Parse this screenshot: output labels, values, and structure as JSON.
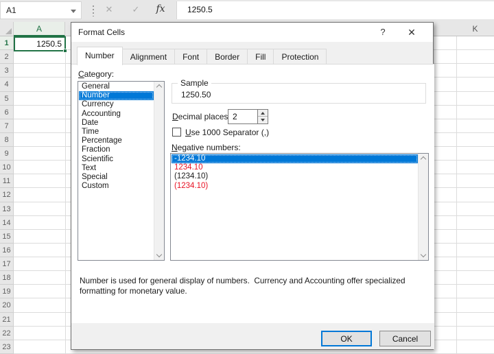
{
  "formula_bar": {
    "name_box": "A1",
    "formula_value": "1250.5",
    "icons": {
      "cancel": "✕",
      "enter": "✓",
      "fx": "fx",
      "dropdown": "▾"
    }
  },
  "grid": {
    "col_a_header": "A",
    "col_k_header": "K",
    "rows": [
      1,
      2,
      3,
      4,
      5,
      6,
      7,
      8,
      9,
      10,
      11,
      12,
      13,
      14,
      15,
      16,
      17,
      18,
      19,
      20,
      21,
      22,
      23
    ],
    "selected_row": 1,
    "selected_column": "A",
    "cell_a1_value": "1250.5"
  },
  "dialog": {
    "title": "Format Cells",
    "help_label": "?",
    "close_label": "✕",
    "tabs": [
      {
        "label": "Number",
        "active": true
      },
      {
        "label": "Alignment",
        "active": false
      },
      {
        "label": "Font",
        "active": false
      },
      {
        "label": "Border",
        "active": false
      },
      {
        "label": "Fill",
        "active": false
      },
      {
        "label": "Protection",
        "active": false
      }
    ],
    "category": {
      "label": "Category:",
      "items": [
        {
          "label": "General",
          "selected": false
        },
        {
          "label": "Number",
          "selected": true
        },
        {
          "label": "Currency",
          "selected": false
        },
        {
          "label": "Accounting",
          "selected": false
        },
        {
          "label": "Date",
          "selected": false
        },
        {
          "label": "Time",
          "selected": false
        },
        {
          "label": "Percentage",
          "selected": false
        },
        {
          "label": "Fraction",
          "selected": false
        },
        {
          "label": "Scientific",
          "selected": false
        },
        {
          "label": "Text",
          "selected": false
        },
        {
          "label": "Special",
          "selected": false
        },
        {
          "label": "Custom",
          "selected": false
        }
      ]
    },
    "sample": {
      "label": "Sample",
      "value": "1250.50"
    },
    "decimal": {
      "label": "Decimal places:",
      "value": "2"
    },
    "separator_checkbox": {
      "label": "Use 1000 Separator (,)",
      "checked": false
    },
    "negative": {
      "label": "Negative numbers:",
      "items": [
        {
          "text": "-1234.10",
          "color": "black",
          "selected": true
        },
        {
          "text": "1234.10",
          "color": "red",
          "selected": false
        },
        {
          "text": "(1234.10)",
          "color": "black",
          "selected": false
        },
        {
          "text": "(1234.10)",
          "color": "red",
          "selected": false
        }
      ]
    },
    "description": "Number is used for general display of numbers.  Currency and Accounting offer specialized\nformatting for monetary value.",
    "buttons": {
      "ok": "OK",
      "cancel": "Cancel"
    }
  },
  "colors": {
    "excel_green": "#217346",
    "selection_blue": "#0078d7",
    "negative_red": "#e81123"
  }
}
